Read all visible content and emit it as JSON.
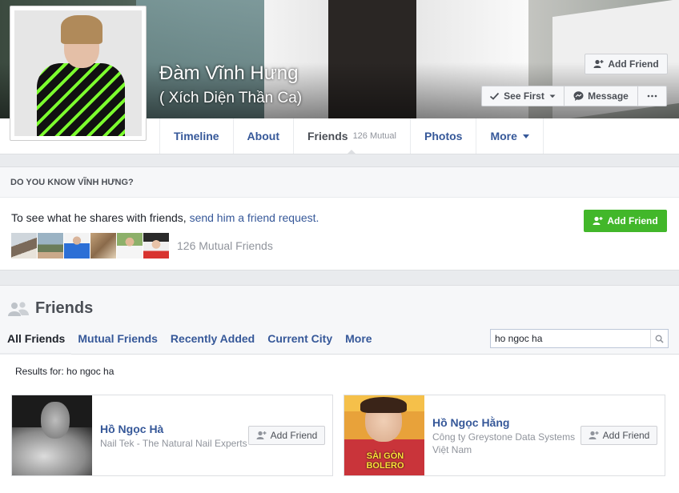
{
  "profile": {
    "name": "Đàm Vĩnh Hưng",
    "alias": "( Xích Diện Thần Ca)"
  },
  "header_buttons": {
    "add_friend": "Add Friend",
    "see_first": "See First",
    "message": "Message"
  },
  "tabs": [
    {
      "label": "Timeline"
    },
    {
      "label": "About"
    },
    {
      "label": "Friends",
      "badge": "126 Mutual"
    },
    {
      "label": "Photos"
    },
    {
      "label": "More"
    }
  ],
  "know": {
    "heading": "DO YOU KNOW VĨNH HƯNG?",
    "text": "To see what he shares with friends, ",
    "link": "send him a friend request.",
    "button": "Add Friend",
    "mutual_count": "126 Mutual Friends"
  },
  "friends": {
    "title": "Friends",
    "tabs": [
      "All Friends",
      "Mutual Friends",
      "Recently Added",
      "Current City",
      "More"
    ],
    "search_value": "ho ngoc ha",
    "results_label": "Results for: ho ngoc ha",
    "cards": [
      {
        "name": "Hồ Ngọc Hà",
        "sub1": "Nail Tek - The Natural Nail Experts",
        "sub2": "",
        "button": "Add Friend"
      },
      {
        "name": "Hồ Ngọc Hằng",
        "sub1": "Công ty Greystone Data Systems",
        "sub2": "Việt Nam",
        "button": "Add Friend",
        "poster_text": "SÀI GÒN BOLERO"
      }
    ]
  },
  "colors": {
    "link": "#365899",
    "green": "#42b72a",
    "muted": "#90949c"
  }
}
